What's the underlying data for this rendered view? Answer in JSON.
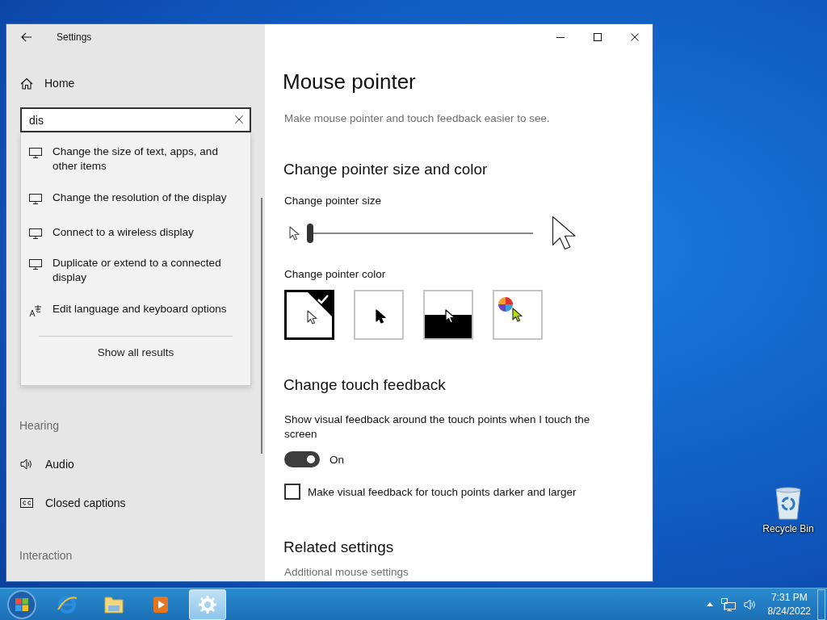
{
  "desktop": {
    "icons": [
      {
        "label": "Recycle Bin"
      }
    ]
  },
  "window": {
    "title": "Settings"
  },
  "sidebar": {
    "home": "Home",
    "search": {
      "value": "dis"
    },
    "suggestions": [
      {
        "kind": "display",
        "text": "Change the size of text, apps, and other items"
      },
      {
        "kind": "display",
        "text": "Change the resolution of the display"
      },
      {
        "kind": "display",
        "text": "Connect to a wireless display"
      },
      {
        "kind": "display",
        "text": "Duplicate or extend to a connected display"
      },
      {
        "kind": "language",
        "text": "Edit language and keyboard options"
      }
    ],
    "show_all": "Show all results",
    "items": [
      {
        "kind": "header",
        "text": "Hearing"
      },
      {
        "kind": "audio",
        "text": "Audio"
      },
      {
        "kind": "captions",
        "text": "Closed captions"
      },
      {
        "kind": "header",
        "text": "Interaction"
      }
    ]
  },
  "content": {
    "title": "Mouse pointer",
    "description": "Make mouse pointer and touch feedback easier to see.",
    "pointer": {
      "heading": "Change pointer size and color",
      "size_label": "Change pointer size",
      "size": {
        "level": 0
      },
      "color_label": "Change pointer color",
      "colors": [
        {
          "kind": "white",
          "selected": true
        },
        {
          "kind": "black",
          "selected": false
        },
        {
          "kind": "inverted",
          "selected": false
        },
        {
          "kind": "custom",
          "selected": false
        }
      ]
    },
    "touch": {
      "heading": "Change touch feedback",
      "toggle_label": "Show visual feedback around the touch points when I touch the screen",
      "toggle": {
        "on": true,
        "text": "On"
      },
      "checkbox": {
        "label": "Make visual feedback for touch points darker and larger",
        "checked": false
      }
    },
    "related": {
      "heading": "Related settings",
      "links": [
        "Additional mouse settings"
      ]
    }
  },
  "taskbar": {
    "apps": [
      {
        "kind": "browser",
        "selected": false
      },
      {
        "kind": "folder",
        "selected": false
      },
      {
        "kind": "media",
        "selected": false
      },
      {
        "kind": "settings",
        "selected": true
      }
    ],
    "time": "7:31 PM",
    "date": "8/24/2022"
  }
}
